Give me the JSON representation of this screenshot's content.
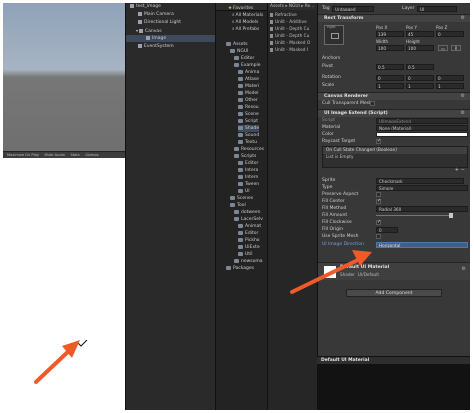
{
  "game_toolbar": {
    "items": [
      "Maximize On Play",
      "Mute Audio",
      "Stats",
      "Gizmos"
    ]
  },
  "hierarchy": {
    "rows": [
      {
        "label": "test_image",
        "selected": false
      },
      {
        "label": "Main Camera",
        "selected": false
      },
      {
        "label": "Directional Light",
        "selected": false
      },
      {
        "label": "Canvas",
        "selected": false
      },
      {
        "label": "Image",
        "selected": true
      },
      {
        "label": "EventSystem",
        "selected": false
      }
    ]
  },
  "project": {
    "favorites": [
      "Favorites",
      "All Materials",
      "All Models",
      "All Prefabs"
    ],
    "tree": [
      "Assets",
      "NGUI",
      "Editor",
      "Example",
      "Anima",
      "Atlase",
      "Materi",
      "Model",
      "Other",
      "Resou",
      "Scene",
      "Script",
      "Shade",
      "Sound",
      "Textu",
      "Resources",
      "Scripts",
      "Editor",
      "Intera",
      "Intern",
      "Tween",
      "UI",
      "Scenes",
      "Tool",
      "dotween",
      "LacerSelv",
      "Animat",
      "Editor",
      "Pickho",
      "UiExte",
      "Util",
      "newsoma",
      "Packages"
    ]
  },
  "assets_list": {
    "path": "Assets ▸ NGUI ▸ Re...",
    "rows": [
      "Refractive",
      "Unlit - Additive",
      "Unlit - Depth Cu",
      "Unlit - Depth Cu",
      "Unlit - Masked O",
      "Unlit - Masked I"
    ]
  },
  "inspector": {
    "tag_label": "Tag",
    "tag_value": "Untagged",
    "layer_label": "Layer",
    "layer_value": "UI",
    "rect_transform": "Rect Transform",
    "anchor_side": "right",
    "pos_x_label": "Pos X",
    "pos_y_label": "Pos Y",
    "pos_z_label": "Pos Z",
    "pos_x": "139",
    "pos_y": "45",
    "pos_z": "0",
    "width_label": "Width",
    "height_label": "Height",
    "width": "100",
    "height": "100",
    "anchors": "Anchors",
    "pivot_label": "Pivot",
    "pivot_x": "0.5",
    "pivot_y": "0.5",
    "rotation_label": "Rotation",
    "rot_x": "0",
    "rot_y": "0",
    "rot_z": "0",
    "scale_label": "Scale",
    "scale_x": "1",
    "scale_y": "1",
    "scale_z": "1",
    "canvas_renderer": "Canvas Renderer",
    "cull_mesh": "Cull Transparent Mesh",
    "ui_image_extend": "UI Image Extend (Script)",
    "script_label": "Script",
    "script_value": "UIImageExtend",
    "material_label": "Material",
    "material_value": "None (Material)",
    "color_label": "Color",
    "raycast_label": "Raycast Target",
    "event_label": "On Cull State Changed (Boolean)",
    "event_empty": "List is Empty",
    "sprite_label": "Sprite",
    "sprite_value": "Checkmark",
    "type_label": "Type",
    "type_value": "Simple",
    "preserve_label": "Preserve Aspect",
    "fill_center_label": "Fill Center",
    "fill_method_label": "Fill Method",
    "fill_method_value": "Radial 360",
    "fill_amount_label": "Fill Amount",
    "fill_clockwise_label": "Fill Clockwise",
    "fill_origin_label": "Fill Origin",
    "fill_origin_value": "0",
    "use_sprite_mesh_label": "Use Sprite Mesh",
    "direction_label": "UI Image Direction",
    "direction_value": "Horizontal",
    "default_material": "Default UI Material",
    "shader_label": "Shader",
    "shader_value": "UI/Default",
    "add_component": "Add Component"
  },
  "preview": {
    "title": "Default UI Material"
  },
  "colors": {
    "arrow": "#f05a28",
    "selection": "#3d4a5c",
    "highlight": "#3e5f8a"
  }
}
